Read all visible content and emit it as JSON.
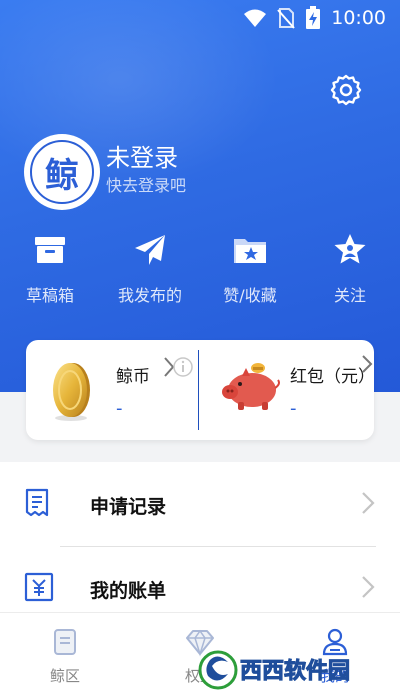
{
  "status_bar": {
    "time": "10:00",
    "icons": [
      "wifi-icon",
      "no-sim-icon",
      "battery-charging-icon"
    ]
  },
  "header": {
    "settings_icon": "gear-icon",
    "user": {
      "avatar_char": "鲸",
      "name": "未登录",
      "subtitle": "快去登录吧"
    },
    "quick_actions": [
      {
        "label": "草稿箱",
        "icon": "archive-box-icon"
      },
      {
        "label": "我发布的",
        "icon": "paper-plane-icon"
      },
      {
        "label": "赞/收藏",
        "icon": "folder-star-icon"
      },
      {
        "label": "关注",
        "icon": "star-person-icon"
      }
    ]
  },
  "wallet": {
    "coins": {
      "label": "鲸币",
      "value": "-",
      "icon": "gold-coin-icon"
    },
    "red_packet": {
      "label": "红包（元）",
      "value": "-",
      "icon": "piggy-bank-icon"
    }
  },
  "menu": [
    {
      "label": "申请记录",
      "icon": "receipt-icon"
    },
    {
      "label": "我的账单",
      "icon": "yen-bill-icon"
    }
  ],
  "bottom_nav": [
    {
      "label": "鲸区",
      "icon": "document-icon",
      "active": false
    },
    {
      "label": "权益",
      "icon": "diamond-icon",
      "active": false
    },
    {
      "label": "我的",
      "icon": "person-icon",
      "active": true
    }
  ],
  "colors": {
    "header_blue": "#2f6be3",
    "accent_blue": "#2c5fd6",
    "background": "#f2f3f5"
  },
  "watermark": {
    "text": "西西软件园",
    "sub": "CR173.COM"
  }
}
